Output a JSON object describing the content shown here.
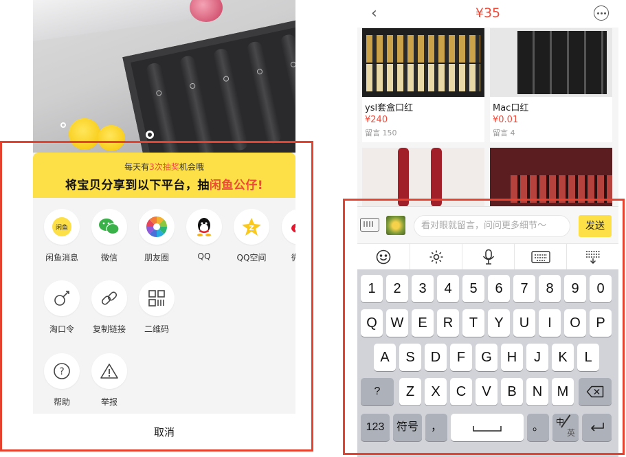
{
  "left": {
    "banner_sub_prefix": "每天有",
    "banner_sub_highlight": "3次抽奖",
    "banner_sub_suffix": "机会哦",
    "banner_main_prefix": "将宝贝分享到以下平台，抽",
    "banner_main_highlight": "闲鱼公仔!",
    "share_row1": [
      {
        "label": "闲鱼消息",
        "icon": "xianyu-message-icon"
      },
      {
        "label": "微信",
        "icon": "wechat-icon"
      },
      {
        "label": "朋友圈",
        "icon": "moments-icon"
      },
      {
        "label": "QQ",
        "icon": "qq-icon"
      },
      {
        "label": "QQ空间",
        "icon": "qzone-icon"
      },
      {
        "label": "微",
        "icon": "weibo-icon"
      }
    ],
    "share_row2": [
      {
        "label": "淘口令",
        "icon": "taokouling-icon"
      },
      {
        "label": "复制链接",
        "icon": "link-icon"
      },
      {
        "label": "二维码",
        "icon": "qrcode-icon"
      }
    ],
    "share_row3": [
      {
        "label": "帮助",
        "icon": "help-icon"
      },
      {
        "label": "举报",
        "icon": "report-icon"
      }
    ],
    "cancel_label": "取消",
    "colors": {
      "accent_red": "#ee4a3a",
      "banner_yellow": "#fde047",
      "frame_red": "#e5432f"
    }
  },
  "right": {
    "header_price": "¥35",
    "products": [
      {
        "name": "ysl套盒口红",
        "price": "¥240",
        "comments": "留言 150"
      },
      {
        "name": "Mac口红",
        "price": "¥0.01",
        "comments": "留言 4"
      }
    ],
    "input_placeholder": "看对眼就留言，问问更多细节～",
    "send_label": "发送",
    "keyboard": {
      "row_numbers": [
        "1",
        "2",
        "3",
        "4",
        "5",
        "6",
        "7",
        "8",
        "9",
        "0"
      ],
      "row_q": [
        "Q",
        "W",
        "E",
        "R",
        "T",
        "Y",
        "U",
        "I",
        "O",
        "P"
      ],
      "row_a": [
        "A",
        "S",
        "D",
        "F",
        "G",
        "H",
        "J",
        "K",
        "L"
      ],
      "row_z": [
        "?",
        "Z",
        "X",
        "C",
        "V",
        "B",
        "N",
        "M"
      ],
      "key_123": "123",
      "key_symbols": "符号",
      "key_comma": "，",
      "key_period": "。",
      "key_lang_top": "中",
      "key_lang_bottom": "英"
    }
  }
}
